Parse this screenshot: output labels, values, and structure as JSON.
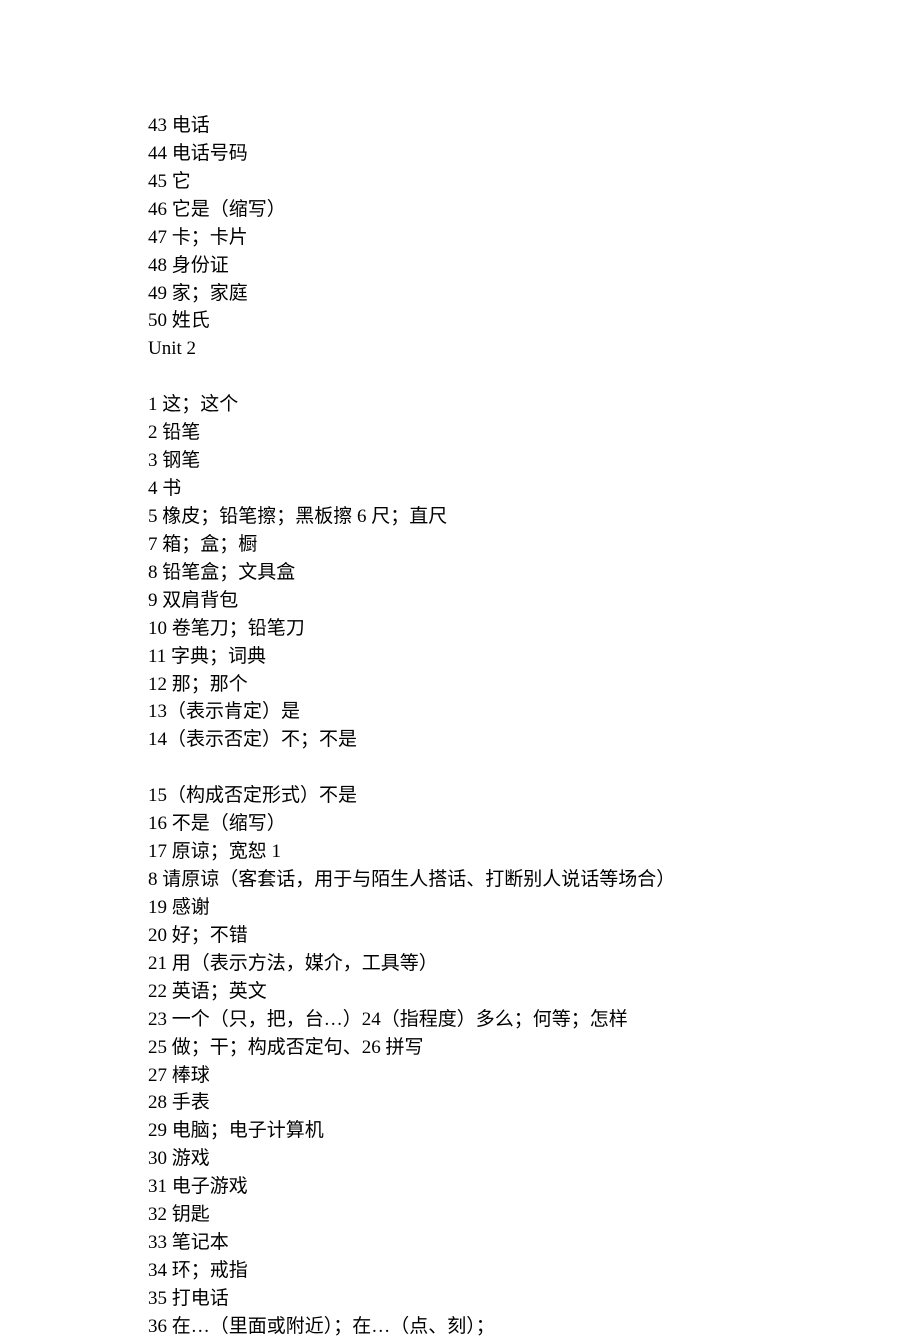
{
  "lines": [
    "43 电话",
    "44 电话号码",
    "45 它",
    "46 它是（缩写）",
    "47 卡；卡片",
    "48 身份证",
    "49 家；家庭",
    "50 姓氏",
    "Unit 2",
    "",
    "1 这；这个",
    "2 铅笔",
    "3 钢笔",
    "4 书",
    "5 橡皮；铅笔擦；黑板擦 6 尺；直尺",
    "7 箱；盒；橱",
    "8 铅笔盒；文具盒",
    "9 双肩背包",
    "10 卷笔刀；铅笔刀",
    "11 字典；词典",
    "12 那；那个",
    "13（表示肯定）是",
    "14（表示否定）不；不是",
    "",
    "15（构成否定形式）不是",
    "16 不是（缩写）",
    "17 原谅；宽恕 1",
    "8 请原谅（客套话，用于与陌生人搭话、打断别人说话等场合）",
    "19 感谢",
    "20 好；不错",
    "21 用（表示方法，媒介，工具等）",
    "22 英语；英文",
    "23 一个（只，把，台…）24（指程度）多么；何等；怎样",
    "25 做；干；构成否定句、26 拼写",
    "27 棒球",
    "28 手表",
    "29 电脑；电子计算机",
    "30 游戏",
    "31 电子游戏",
    "32 钥匙",
    "33 笔记本",
    "34 环；戒指",
    "35 打电话",
    "36 在…（里面或附近）；在…（点、刻）；"
  ]
}
